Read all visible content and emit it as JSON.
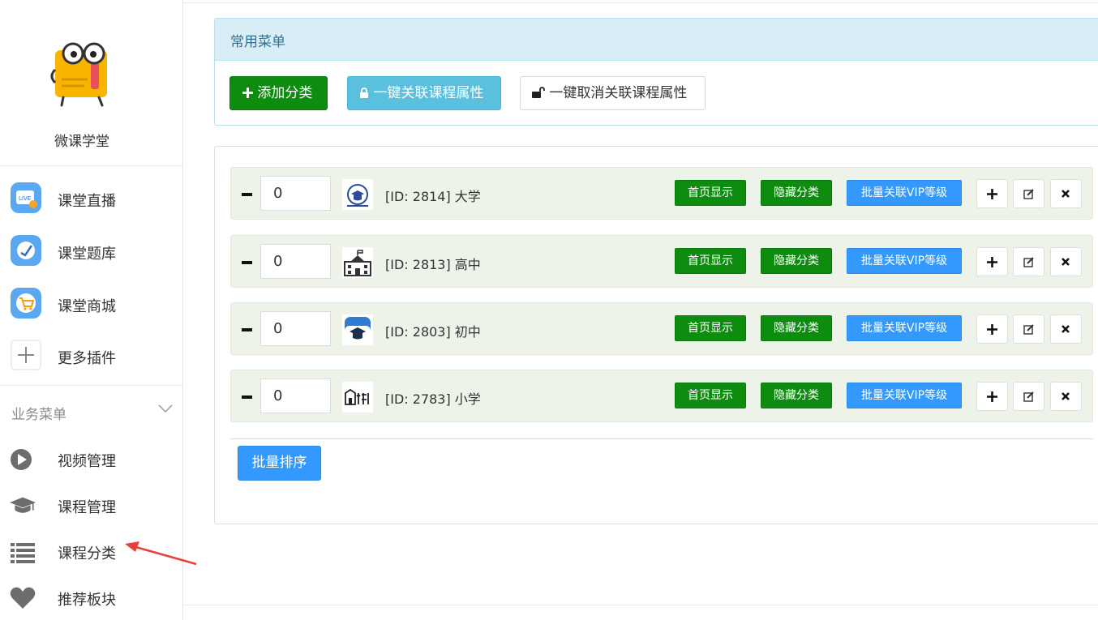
{
  "brand": {
    "name": "微课学堂"
  },
  "plugins": [
    {
      "label": "课堂直播",
      "icon": "live-tv-icon"
    },
    {
      "label": "课堂题库",
      "icon": "question-bank-icon"
    },
    {
      "label": "课堂商城",
      "icon": "shopping-cart-icon"
    },
    {
      "label": "更多插件",
      "icon": "plus-icon"
    }
  ],
  "business_menu": {
    "title": "业务菜单",
    "items": [
      {
        "label": "视频管理",
        "icon": "play-circle-icon"
      },
      {
        "label": "课程管理",
        "icon": "graduation-cap-icon"
      },
      {
        "label": "课程分类",
        "icon": "list-icon"
      },
      {
        "label": "推荐板块",
        "icon": "heart-icon"
      }
    ]
  },
  "toolbar": {
    "title": "常用菜单",
    "add_label": "添加分类",
    "link_label": "一键关联课程属性",
    "unlink_label": "一键取消关联课程属性"
  },
  "categories": [
    {
      "sort": "0",
      "name": "[ID: 2814] 大学",
      "thumb": "university-icon"
    },
    {
      "sort": "0",
      "name": "[ID: 2813] 高中",
      "thumb": "school-building-icon"
    },
    {
      "sort": "0",
      "name": "[ID: 2803] 初中",
      "thumb": "zhongkao-icon"
    },
    {
      "sort": "0",
      "name": "[ID: 2783] 小学",
      "thumb": "primary-school-icon"
    }
  ],
  "row_actions": {
    "home_label": "首页显示",
    "hide_label": "隐藏分类",
    "vip_label": "批量关联VIP等级"
  },
  "batch_sort_label": "批量排序",
  "colors": {
    "green": "#0e8c10",
    "info": "#5bc0de",
    "blue": "#3399ff",
    "panel_head": "#d9edf7",
    "row_bg": "#eef3ea",
    "arrow": "#e8413b"
  }
}
